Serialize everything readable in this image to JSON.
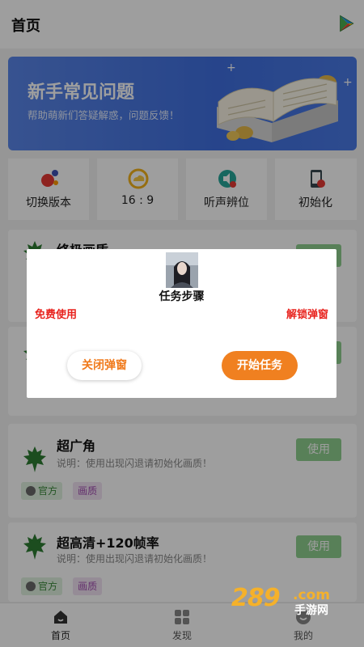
{
  "header": {
    "title": "首页"
  },
  "banner": {
    "title": "新手常见问题",
    "subtitle": "帮助萌新们答疑解惑，问题反馈！"
  },
  "shortcuts": [
    {
      "label": "切换版本",
      "icon": "molecule-icon"
    },
    {
      "label": "16 : 9",
      "icon": "cloud-ring-icon"
    },
    {
      "label": "听声辨位",
      "icon": "sound-icon"
    },
    {
      "label": "初始化",
      "icon": "phone-reset-icon"
    }
  ],
  "cards": [
    {
      "name": "终极画质",
      "desc": "",
      "button": "使用",
      "tags": []
    },
    {
      "name": "",
      "desc": "",
      "button": "使用",
      "tags": []
    },
    {
      "name": "超广角",
      "desc": "说明：使用出现闪退请初始化画质！",
      "button": "使用",
      "tags": [
        "官方",
        "画质"
      ]
    },
    {
      "name": "超高清+120帧率",
      "desc": "说明：使用出现闪退请初始化画质！",
      "button": "使用",
      "tags": [
        "官方",
        "画质"
      ]
    }
  ],
  "bottom_nav": [
    {
      "label": "首页",
      "icon": "home-icon"
    },
    {
      "label": "发现",
      "icon": "grid-icon"
    },
    {
      "label": "我的",
      "icon": "profile-icon"
    }
  ],
  "dialog": {
    "title": "任务步骤",
    "left_text": "免费使用",
    "right_text": "解锁弹窗",
    "close_button": "关闭弹窗",
    "start_button": "开始任务"
  },
  "watermark": {
    "number": "289",
    "domain": ".com",
    "site": "手游网"
  },
  "colors": {
    "accent": "#f08020",
    "banner": "#3f6fe0",
    "use_button": "#8fcf8f",
    "alert_red": "#e8231e"
  }
}
